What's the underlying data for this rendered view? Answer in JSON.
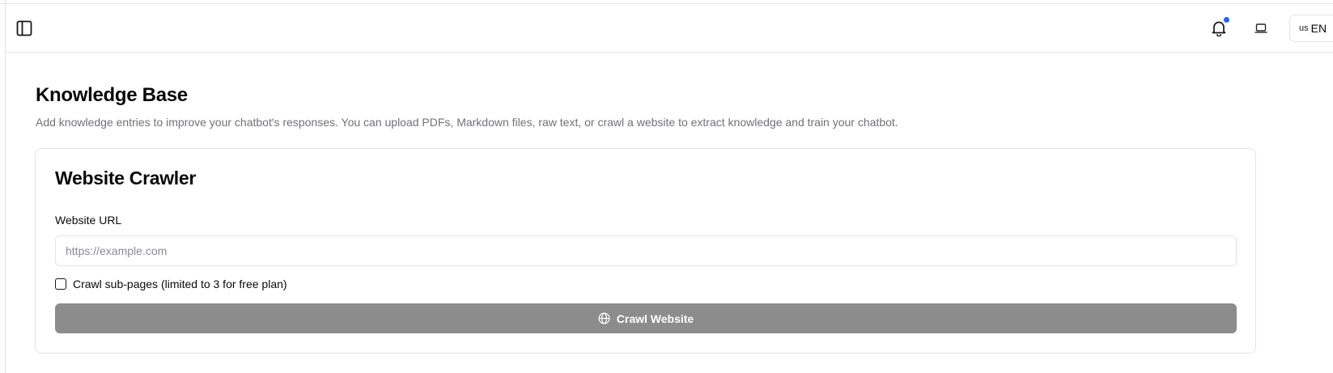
{
  "header": {
    "sidebar_toggle_icon": "panel-left-icon",
    "notification_icon": "bell-icon",
    "notification_dot_color": "#2563eb",
    "device_icon": "laptop-icon",
    "language": {
      "flag": "us",
      "code": "EN"
    }
  },
  "page": {
    "title": "Knowledge Base",
    "description": "Add knowledge entries to improve your chatbot's responses. You can upload PDFs, Markdown files, raw text, or crawl a website to extract knowledge and train your chatbot."
  },
  "crawler": {
    "title": "Website Crawler",
    "url_label": "Website URL",
    "url_value": "",
    "url_placeholder": "https://example.com",
    "subpages_checked": false,
    "subpages_label": "Crawl sub-pages (limited to 3 for free plan)",
    "button_icon": "globe-icon",
    "button_label": "Crawl Website",
    "button_color": "#8c8c8c"
  }
}
